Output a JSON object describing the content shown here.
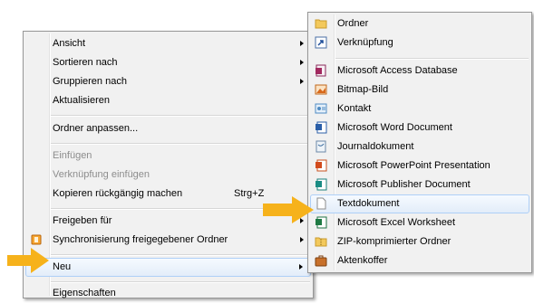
{
  "context_menu": {
    "items": [
      {
        "label": "Ansicht"
      },
      {
        "label": "Sortieren nach"
      },
      {
        "label": "Gruppieren nach"
      },
      {
        "label": "Aktualisieren"
      },
      {
        "label": "Ordner anpassen..."
      },
      {
        "label": "Einfügen"
      },
      {
        "label": "Verknüpfung einfügen"
      },
      {
        "label": "Kopieren rückgängig machen",
        "shortcut": "Strg+Z"
      },
      {
        "label": "Freigeben für"
      },
      {
        "label": "Synchronisierung freigegebener Ordner",
        "icon": "sync-folder-icon"
      },
      {
        "label": "Neu"
      },
      {
        "label": "Eigenschaften"
      }
    ]
  },
  "submenu_neu": {
    "items": [
      {
        "label": "Ordner",
        "icon": "folder-icon"
      },
      {
        "label": "Verknüpfung",
        "icon": "shortcut-icon"
      },
      {
        "label": "Microsoft Access Database",
        "icon": "access-icon"
      },
      {
        "label": "Bitmap-Bild",
        "icon": "bitmap-icon"
      },
      {
        "label": "Kontakt",
        "icon": "contact-icon"
      },
      {
        "label": "Microsoft Word Document",
        "icon": "word-icon"
      },
      {
        "label": "Journaldokument",
        "icon": "journal-icon"
      },
      {
        "label": "Microsoft PowerPoint Presentation",
        "icon": "powerpoint-icon"
      },
      {
        "label": "Microsoft Publisher Document",
        "icon": "publisher-icon"
      },
      {
        "label": "Textdokument",
        "icon": "text-document-icon"
      },
      {
        "label": "Microsoft Excel Worksheet",
        "icon": "excel-icon"
      },
      {
        "label": "ZIP-komprimierter Ordner",
        "icon": "zip-folder-icon"
      },
      {
        "label": "Aktenkoffer",
        "icon": "briefcase-icon"
      }
    ]
  },
  "colors": {
    "highlight_border": "#aecff7",
    "pointer_arrow": "#f6b21b",
    "disabled_text": "#8d8d8d"
  }
}
